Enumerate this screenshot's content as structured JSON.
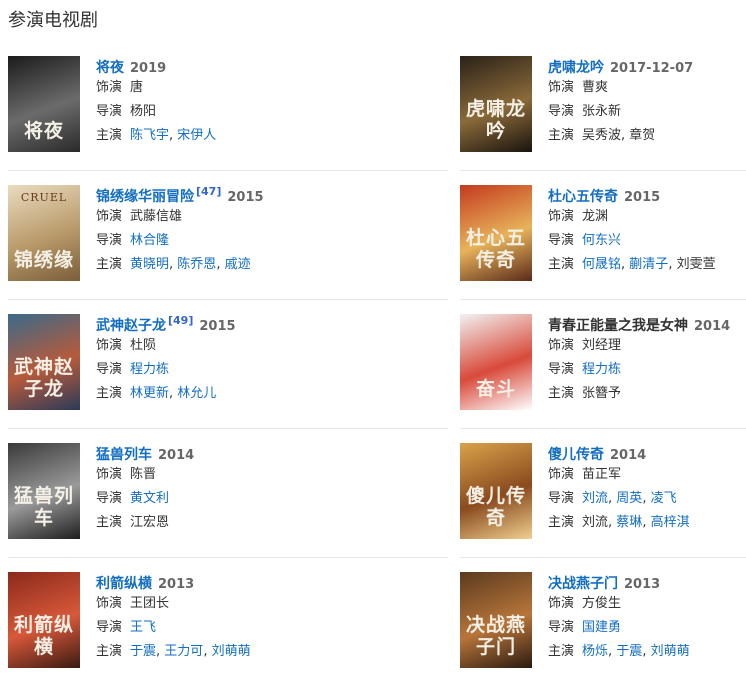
{
  "section_title": "参演电视剧",
  "items": [
    {
      "title": "将夜",
      "ref": "",
      "year": "2019",
      "title_link": true,
      "poster_text": "将夜",
      "poster_sub": "",
      "poster_colors": [
        "#1b1b1b",
        "#6b6b6b",
        "#2a2a2a"
      ],
      "role_label": "饰演",
      "role": "唐",
      "director_label": "导演",
      "directors": [
        {
          "name": "杨阳",
          "link": false
        }
      ],
      "star_label": "主演",
      "stars": [
        {
          "name": "陈飞宇",
          "link": true
        },
        {
          "name": "宋伊人",
          "link": true
        }
      ]
    },
    {
      "title": "虎啸龙吟",
      "ref": "",
      "year": "2017-12-07",
      "title_link": true,
      "poster_text": "虎啸龙吟",
      "poster_sub": "",
      "poster_colors": [
        "#2a2118",
        "#8a6a3a",
        "#1a140e"
      ],
      "role_label": "饰演",
      "role": "曹爽",
      "director_label": "导演",
      "directors": [
        {
          "name": "张永新",
          "link": false
        }
      ],
      "star_label": "主演",
      "stars": [
        {
          "name": "吴秀波",
          "link": false
        },
        {
          "name": "章贺",
          "link": false
        }
      ]
    },
    {
      "title": "锦绣缘华丽冒险",
      "ref": "[47]",
      "year": "2015",
      "title_link": true,
      "poster_text": "锦绣缘",
      "poster_sub": "CRUEL",
      "poster_colors": [
        "#e9dcc0",
        "#b99a6a",
        "#7a5d3a"
      ],
      "role_label": "饰演",
      "role": "武藤信雄",
      "director_label": "导演",
      "directors": [
        {
          "name": "林合隆",
          "link": true
        }
      ],
      "star_label": "主演",
      "stars": [
        {
          "name": "黄晓明",
          "link": true
        },
        {
          "name": "陈乔恩",
          "link": true
        },
        {
          "name": "戚迹",
          "link": true
        }
      ]
    },
    {
      "title": "杜心五传奇",
      "ref": "",
      "year": "2015",
      "title_link": true,
      "poster_text": "杜心五传奇",
      "poster_sub": "",
      "poster_colors": [
        "#c43a1e",
        "#e7b35a",
        "#5a2a1a"
      ],
      "role_label": "饰演",
      "role": "龙渊",
      "director_label": "导演",
      "directors": [
        {
          "name": "何东兴",
          "link": true
        }
      ],
      "star_label": "主演",
      "stars": [
        {
          "name": "何晟铭",
          "link": true
        },
        {
          "name": "蒯清子",
          "link": true
        },
        {
          "name": "刘雯萱",
          "link": false
        }
      ]
    },
    {
      "title": "武神赵子龙",
      "ref": "[49]",
      "year": "2015",
      "title_link": true,
      "poster_text": "武神赵子龙",
      "poster_sub": "",
      "poster_colors": [
        "#3a6a8a",
        "#b85a3a",
        "#2a3a5a"
      ],
      "role_label": "饰演",
      "role": "杜陨",
      "director_label": "导演",
      "directors": [
        {
          "name": "程力栋",
          "link": true
        }
      ],
      "star_label": "主演",
      "stars": [
        {
          "name": "林更新",
          "link": true
        },
        {
          "name": "林允儿",
          "link": true
        }
      ]
    },
    {
      "title": "青春正能量之我是女神",
      "ref": "",
      "year": "2014",
      "title_link": false,
      "poster_text": "奋斗",
      "poster_sub": "",
      "poster_colors": [
        "#f2f2f2",
        "#d84a3a",
        "#ffffff"
      ],
      "role_label": "饰演",
      "role": "刘经理",
      "director_label": "导演",
      "directors": [
        {
          "name": "程力栋",
          "link": true
        }
      ],
      "star_label": "主演",
      "stars": [
        {
          "name": "张簪予",
          "link": false
        }
      ]
    },
    {
      "title": "猛兽列车",
      "ref": "",
      "year": "2014",
      "title_link": true,
      "poster_text": "猛兽列车",
      "poster_sub": "",
      "poster_colors": [
        "#3a3a3a",
        "#9a9a9a",
        "#1e1e1e"
      ],
      "role_label": "饰演",
      "role": "陈晋",
      "director_label": "导演",
      "directors": [
        {
          "name": "黄文利",
          "link": true
        }
      ],
      "star_label": "主演",
      "stars": [
        {
          "name": "江宏恩",
          "link": false
        }
      ]
    },
    {
      "title": "傻儿传奇",
      "ref": "",
      "year": "2014",
      "title_link": true,
      "poster_text": "傻儿传奇",
      "poster_sub": "",
      "poster_colors": [
        "#d9a24a",
        "#8a4a1e",
        "#f0d090"
      ],
      "role_label": "饰演",
      "role": "苗正军",
      "director_label": "导演",
      "directors": [
        {
          "name": "刘流",
          "link": true
        },
        {
          "name": "周英",
          "link": true
        },
        {
          "name": "凌飞",
          "link": true
        }
      ],
      "star_label": "主演",
      "stars": [
        {
          "name": "刘流",
          "link": false
        },
        {
          "name": "蔡琳",
          "link": true
        },
        {
          "name": "高梓淇",
          "link": true
        }
      ]
    },
    {
      "title": "利箭纵横",
      "ref": "",
      "year": "2013",
      "title_link": true,
      "poster_text": "利箭纵横",
      "poster_sub": "",
      "poster_colors": [
        "#8a2a1a",
        "#d8583a",
        "#3a1a12"
      ],
      "role_label": "饰演",
      "role": "王团长",
      "director_label": "导演",
      "directors": [
        {
          "name": "王飞",
          "link": true
        }
      ],
      "star_label": "主演",
      "stars": [
        {
          "name": "于震",
          "link": true
        },
        {
          "name": "王力可",
          "link": true
        },
        {
          "name": "刘萌萌",
          "link": true
        }
      ]
    },
    {
      "title": "决战燕子门",
      "ref": "",
      "year": "2013",
      "title_link": true,
      "poster_text": "决战燕子门",
      "poster_sub": "",
      "poster_colors": [
        "#5a3a1e",
        "#b8753a",
        "#2a1a10"
      ],
      "role_label": "饰演",
      "role": "方俊生",
      "director_label": "导演",
      "directors": [
        {
          "name": "国建勇",
          "link": true
        }
      ],
      "star_label": "主演",
      "stars": [
        {
          "name": "杨烁",
          "link": true
        },
        {
          "name": "于震",
          "link": true
        },
        {
          "name": "刘萌萌",
          "link": true
        }
      ]
    }
  ]
}
